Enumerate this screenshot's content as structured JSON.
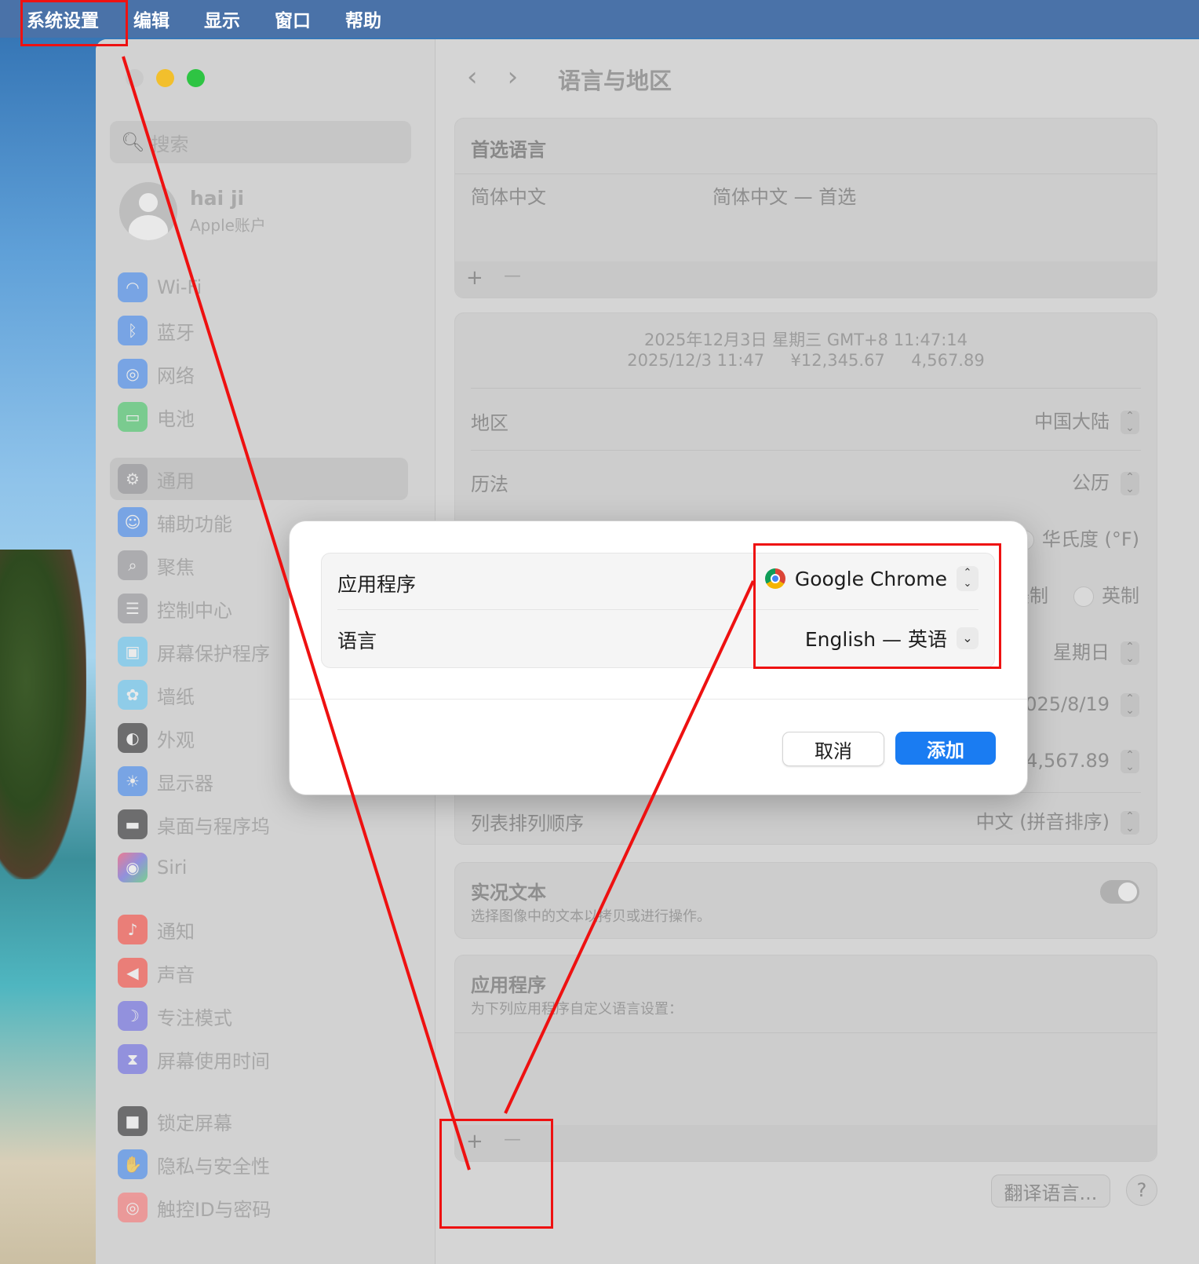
{
  "menubar": {
    "items": [
      "系统设置",
      "编辑",
      "显示",
      "窗口",
      "帮助"
    ]
  },
  "sidebar": {
    "search_placeholder": "搜索",
    "user": {
      "name": "hai ji",
      "subtitle": "Apple账户"
    },
    "items": [
      {
        "label": "Wi-Fi",
        "icon": "wifi-icon"
      },
      {
        "label": "蓝牙",
        "icon": "bluetooth-icon"
      },
      {
        "label": "网络",
        "icon": "globe-icon"
      },
      {
        "label": "电池",
        "icon": "battery-icon"
      },
      {
        "label": "通用",
        "icon": "gear-icon"
      },
      {
        "label": "辅助功能",
        "icon": "accessibility-icon"
      },
      {
        "label": "聚焦",
        "icon": "spotlight-icon"
      },
      {
        "label": "控制中心",
        "icon": "control-center-icon"
      },
      {
        "label": "屏幕保护程序",
        "icon": "screensaver-icon"
      },
      {
        "label": "墙纸",
        "icon": "wallpaper-icon"
      },
      {
        "label": "外观",
        "icon": "appearance-icon"
      },
      {
        "label": "显示器",
        "icon": "display-icon"
      },
      {
        "label": "桌面与程序坞",
        "icon": "dock-icon"
      },
      {
        "label": "Siri",
        "icon": "siri-icon"
      },
      {
        "label": "通知",
        "icon": "bell-icon"
      },
      {
        "label": "声音",
        "icon": "speaker-icon"
      },
      {
        "label": "专注模式",
        "icon": "moon-icon"
      },
      {
        "label": "屏幕使用时间",
        "icon": "hourglass-icon"
      },
      {
        "label": "锁定屏幕",
        "icon": "lock-icon"
      },
      {
        "label": "隐私与安全性",
        "icon": "hand-icon"
      },
      {
        "label": "触控ID与密码",
        "icon": "fingerprint-icon"
      }
    ]
  },
  "main": {
    "title": "语言与地区",
    "preferred": {
      "header": "首选语言",
      "language": "简体中文",
      "language_detail": "简体中文 — 首选",
      "add": "+",
      "remove": "—"
    },
    "format_preview": {
      "line1": "2025年12月3日 星期三 GMT+8 11:47:14",
      "line2_date": "2025/12/3 11:47",
      "line2_currency": "¥12,345.67",
      "line2_number": "4,567.89"
    },
    "region": {
      "label": "地区",
      "value": "中国大陆"
    },
    "calendar": {
      "label": "历法",
      "value": "公历"
    },
    "temperature_option": "华氏度 (°F)",
    "measure_us": "美制",
    "measure_uk": "英制",
    "first_day": "星期日",
    "date_format": "2025/8/19",
    "number_format": ",234,567.89",
    "list_sort": {
      "label": "列表排列顺序",
      "value": "中文 (拼音排序)"
    },
    "live_text": {
      "title": "实况文本",
      "desc": "选择图像中的文本以拷贝或进行操作。"
    },
    "applications": {
      "title": "应用程序",
      "desc": "为下列应用程序自定义语言设置：",
      "add": "+",
      "remove": "—"
    },
    "translate_button": "翻译语言...",
    "help_button": "?"
  },
  "dialog": {
    "app_label": "应用程序",
    "app_value": "Google Chrome",
    "lang_label": "语言",
    "lang_value": "English — 英语",
    "cancel": "取消",
    "add": "添加"
  },
  "colors": {
    "accent": "#1a7cf2",
    "annotation": "#ee1111",
    "menubar": "#4a72a8"
  }
}
